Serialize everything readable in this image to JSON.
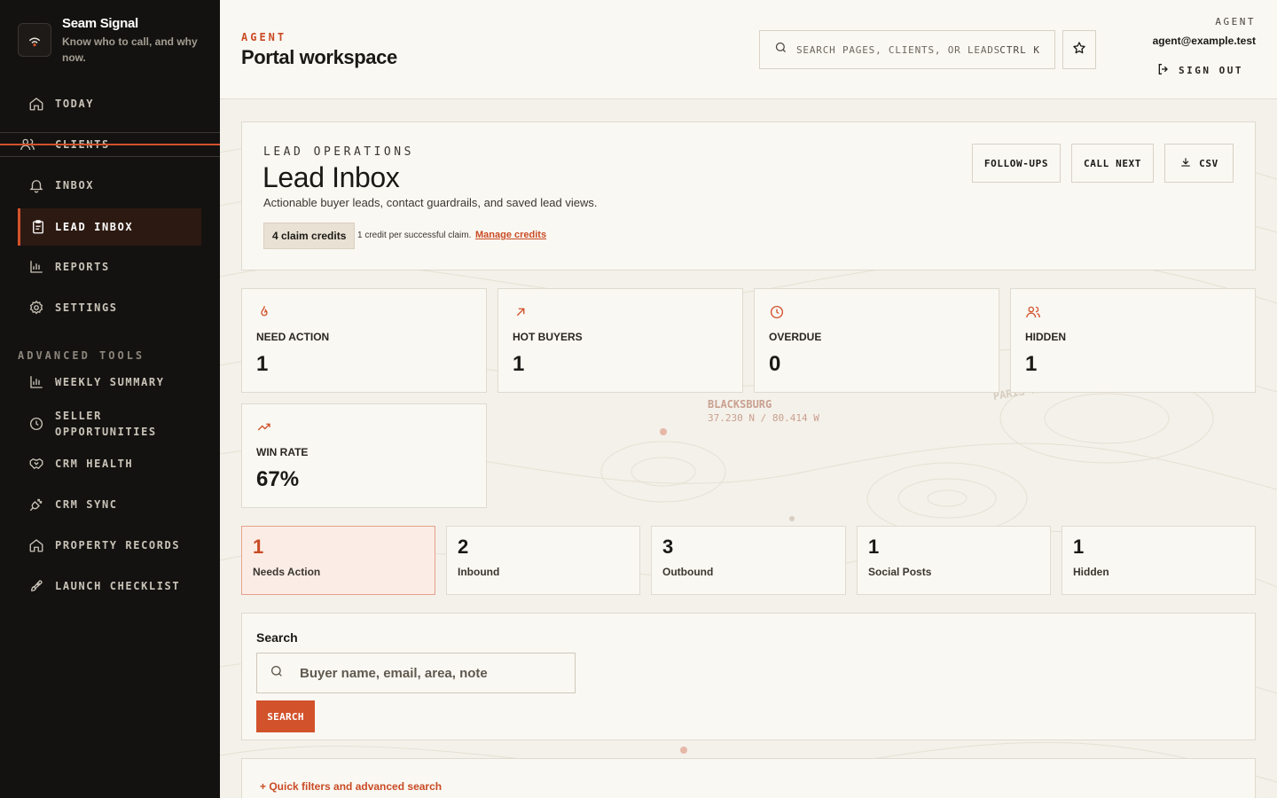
{
  "brand": {
    "title": "Seam Signal",
    "subtitle": "Know who to call, and why now."
  },
  "sidebar": {
    "items": [
      {
        "label": "TODAY",
        "icon": "home-icon"
      },
      {
        "label": "CLIENTS",
        "icon": "users-icon"
      },
      {
        "label": "INBOX",
        "icon": "bell-icon"
      },
      {
        "label": "LEAD INBOX",
        "icon": "clipboard-icon",
        "active": true
      },
      {
        "label": "REPORTS",
        "icon": "bar-chart-icon"
      },
      {
        "label": "SETTINGS",
        "icon": "gear-icon"
      }
    ],
    "section_label": "ADVANCED TOOLS",
    "advanced": [
      {
        "label": "WEEKLY SUMMARY",
        "icon": "bar-chart-icon"
      },
      {
        "label": "SELLER OPPORTUNITIES",
        "icon": "clock-icon"
      },
      {
        "label": "CRM HEALTH",
        "icon": "handshake-icon"
      },
      {
        "label": "CRM SYNC",
        "icon": "plug-icon"
      },
      {
        "label": "PROPERTY RECORDS",
        "icon": "house-icon"
      },
      {
        "label": "LAUNCH CHECKLIST",
        "icon": "rocket-icon"
      }
    ]
  },
  "header": {
    "eyebrow": "AGENT",
    "title": "Portal workspace",
    "search_placeholder": "SEARCH PAGES, CLIENTS, OR LEADS",
    "search_shortcut": "CTRL K",
    "role": "AGENT",
    "email": "agent@example.test",
    "signout": "SIGN OUT"
  },
  "lead_ops": {
    "eyebrow": "LEAD OPERATIONS",
    "title": "Lead Inbox",
    "description": "Actionable buyer leads, contact guardrails, and saved lead views.",
    "credits_badge": "4 claim credits",
    "credit_note": "1 credit per successful claim.",
    "manage_link": "Manage credits",
    "buttons": {
      "followups": "FOLLOW-UPS",
      "call_next": "CALL NEXT",
      "csv": "CSV"
    }
  },
  "stats": [
    {
      "label": "NEED ACTION",
      "value": "1",
      "icon": "flame-icon"
    },
    {
      "label": "HOT BUYERS",
      "value": "1",
      "icon": "arrow-up-right-icon"
    },
    {
      "label": "OVERDUE",
      "value": "0",
      "icon": "clock-icon"
    },
    {
      "label": "HIDDEN",
      "value": "1",
      "icon": "users-icon"
    },
    {
      "label": "WIN RATE",
      "value": "67%",
      "icon": "trending-up-icon"
    }
  ],
  "tabs": [
    {
      "count": "1",
      "label": "Needs Action",
      "active": true
    },
    {
      "count": "2",
      "label": "Inbound"
    },
    {
      "count": "3",
      "label": "Outbound"
    },
    {
      "count": "1",
      "label": "Social Posts"
    },
    {
      "count": "1",
      "label": "Hidden"
    }
  ],
  "search": {
    "label": "Search",
    "placeholder": "Buyer name, email, area, note",
    "button": "SEARCH"
  },
  "filters": {
    "toggle": "+ Quick filters and advanced search"
  },
  "map": {
    "place": "BLACKSBURG",
    "coords": "37.230 N / 80.414 W",
    "mountain": "PARIS MOUNTAIN"
  },
  "colors": {
    "accent": "#d2522b",
    "sidebar_bg": "#141210",
    "page_bg": "#f4f1ea"
  }
}
